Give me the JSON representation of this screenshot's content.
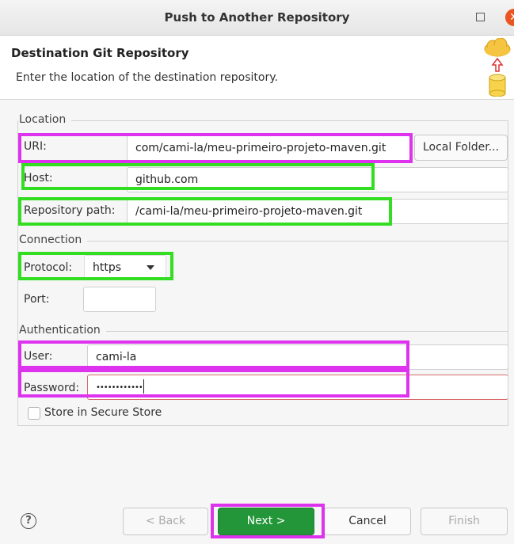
{
  "window": {
    "title": "Push to Another Repository",
    "maximize_icon": "maximize-icon",
    "close_icon": "close-icon",
    "close_glyph": "✕",
    "close_color": "#e95420"
  },
  "header": {
    "title": "Destination Git Repository",
    "description": "Enter the location of the destination repository.",
    "icon": "cloud-push-database-icon"
  },
  "location": {
    "group_label": "Location",
    "uri_label": "URI:",
    "uri_value": "com/cami-la/meu-primeiro-projeto-maven.git",
    "local_folder_button": "Local Folder...",
    "host_label": "Host:",
    "host_value": "github.com",
    "repo_path_label": "Repository path:",
    "repo_path_value": "/cami-la/meu-primeiro-projeto-maven.git"
  },
  "connection": {
    "group_label": "Connection",
    "protocol_label": "Protocol:",
    "protocol_value": "https",
    "port_label": "Port:",
    "port_value": ""
  },
  "authentication": {
    "group_label": "Authentication",
    "user_label": "User:",
    "user_value": "cami-la",
    "password_label": "Password:",
    "password_value": "••••••••••••",
    "store_label": "Store in Secure Store",
    "store_checked": false
  },
  "footer": {
    "help_glyph": "?",
    "back_button": "< Back",
    "next_button": "Next >",
    "cancel_button": "Cancel",
    "finish_button": "Finish"
  },
  "colors": {
    "highlight_green": "#33dd22",
    "highlight_magenta": "#dd33ee",
    "next_button_green": "#24963a"
  }
}
